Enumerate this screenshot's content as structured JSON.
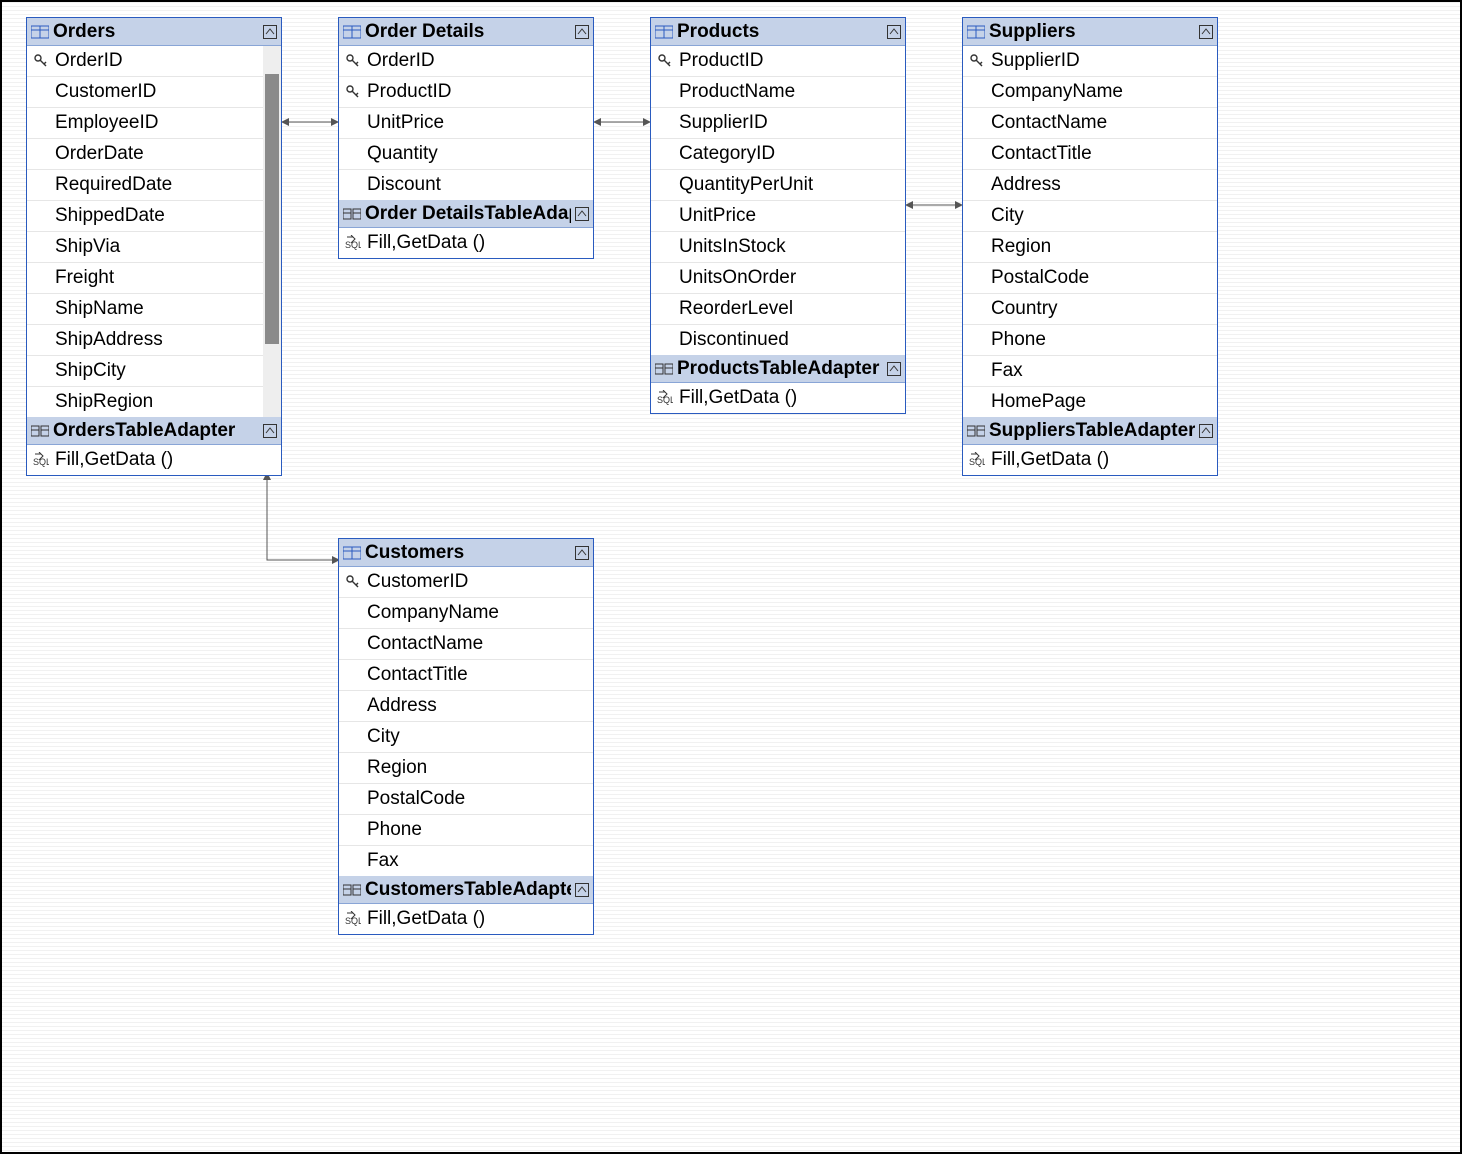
{
  "tables": {
    "orders": {
      "title": "Orders",
      "adapter": "OrdersTableAdapter",
      "method": "Fill,GetData ()",
      "columns": [
        {
          "name": "OrderID",
          "key": true
        },
        {
          "name": "CustomerID",
          "key": false
        },
        {
          "name": "EmployeeID",
          "key": false
        },
        {
          "name": "OrderDate",
          "key": false
        },
        {
          "name": "RequiredDate",
          "key": false
        },
        {
          "name": "ShippedDate",
          "key": false
        },
        {
          "name": "ShipVia",
          "key": false
        },
        {
          "name": "Freight",
          "key": false
        },
        {
          "name": "ShipName",
          "key": false
        },
        {
          "name": "ShipAddress",
          "key": false
        },
        {
          "name": "ShipCity",
          "key": false
        },
        {
          "name": "ShipRegion",
          "key": false
        }
      ],
      "scroll": true
    },
    "order_details": {
      "title": "Order Details",
      "adapter": "Order DetailsTableAdapter",
      "method": "Fill,GetData ()",
      "columns": [
        {
          "name": "OrderID",
          "key": true
        },
        {
          "name": "ProductID",
          "key": true
        },
        {
          "name": "UnitPrice",
          "key": false
        },
        {
          "name": "Quantity",
          "key": false
        },
        {
          "name": "Discount",
          "key": false
        }
      ],
      "scroll": false
    },
    "products": {
      "title": "Products",
      "adapter": "ProductsTableAdapter",
      "method": "Fill,GetData ()",
      "columns": [
        {
          "name": "ProductID",
          "key": true
        },
        {
          "name": "ProductName",
          "key": false
        },
        {
          "name": "SupplierID",
          "key": false
        },
        {
          "name": "CategoryID",
          "key": false
        },
        {
          "name": "QuantityPerUnit",
          "key": false
        },
        {
          "name": "UnitPrice",
          "key": false
        },
        {
          "name": "UnitsInStock",
          "key": false
        },
        {
          "name": "UnitsOnOrder",
          "key": false
        },
        {
          "name": "ReorderLevel",
          "key": false
        },
        {
          "name": "Discontinued",
          "key": false
        }
      ],
      "scroll": false
    },
    "suppliers": {
      "title": "Suppliers",
      "adapter": "SuppliersTableAdapter",
      "method": "Fill,GetData ()",
      "columns": [
        {
          "name": "SupplierID",
          "key": true
        },
        {
          "name": "CompanyName",
          "key": false
        },
        {
          "name": "ContactName",
          "key": false
        },
        {
          "name": "ContactTitle",
          "key": false
        },
        {
          "name": "Address",
          "key": false
        },
        {
          "name": "City",
          "key": false
        },
        {
          "name": "Region",
          "key": false
        },
        {
          "name": "PostalCode",
          "key": false
        },
        {
          "name": "Country",
          "key": false
        },
        {
          "name": "Phone",
          "key": false
        },
        {
          "name": "Fax",
          "key": false
        },
        {
          "name": "HomePage",
          "key": false
        }
      ],
      "scroll": false
    },
    "customers": {
      "title": "Customers",
      "adapter": "CustomersTableAdapter",
      "method": "Fill,GetData ()",
      "columns": [
        {
          "name": "CustomerID",
          "key": true
        },
        {
          "name": "CompanyName",
          "key": false
        },
        {
          "name": "ContactName",
          "key": false
        },
        {
          "name": "ContactTitle",
          "key": false
        },
        {
          "name": "Address",
          "key": false
        },
        {
          "name": "City",
          "key": false
        },
        {
          "name": "Region",
          "key": false
        },
        {
          "name": "PostalCode",
          "key": false
        },
        {
          "name": "Phone",
          "key": false
        },
        {
          "name": "Fax",
          "key": false
        }
      ],
      "scroll": false
    }
  }
}
